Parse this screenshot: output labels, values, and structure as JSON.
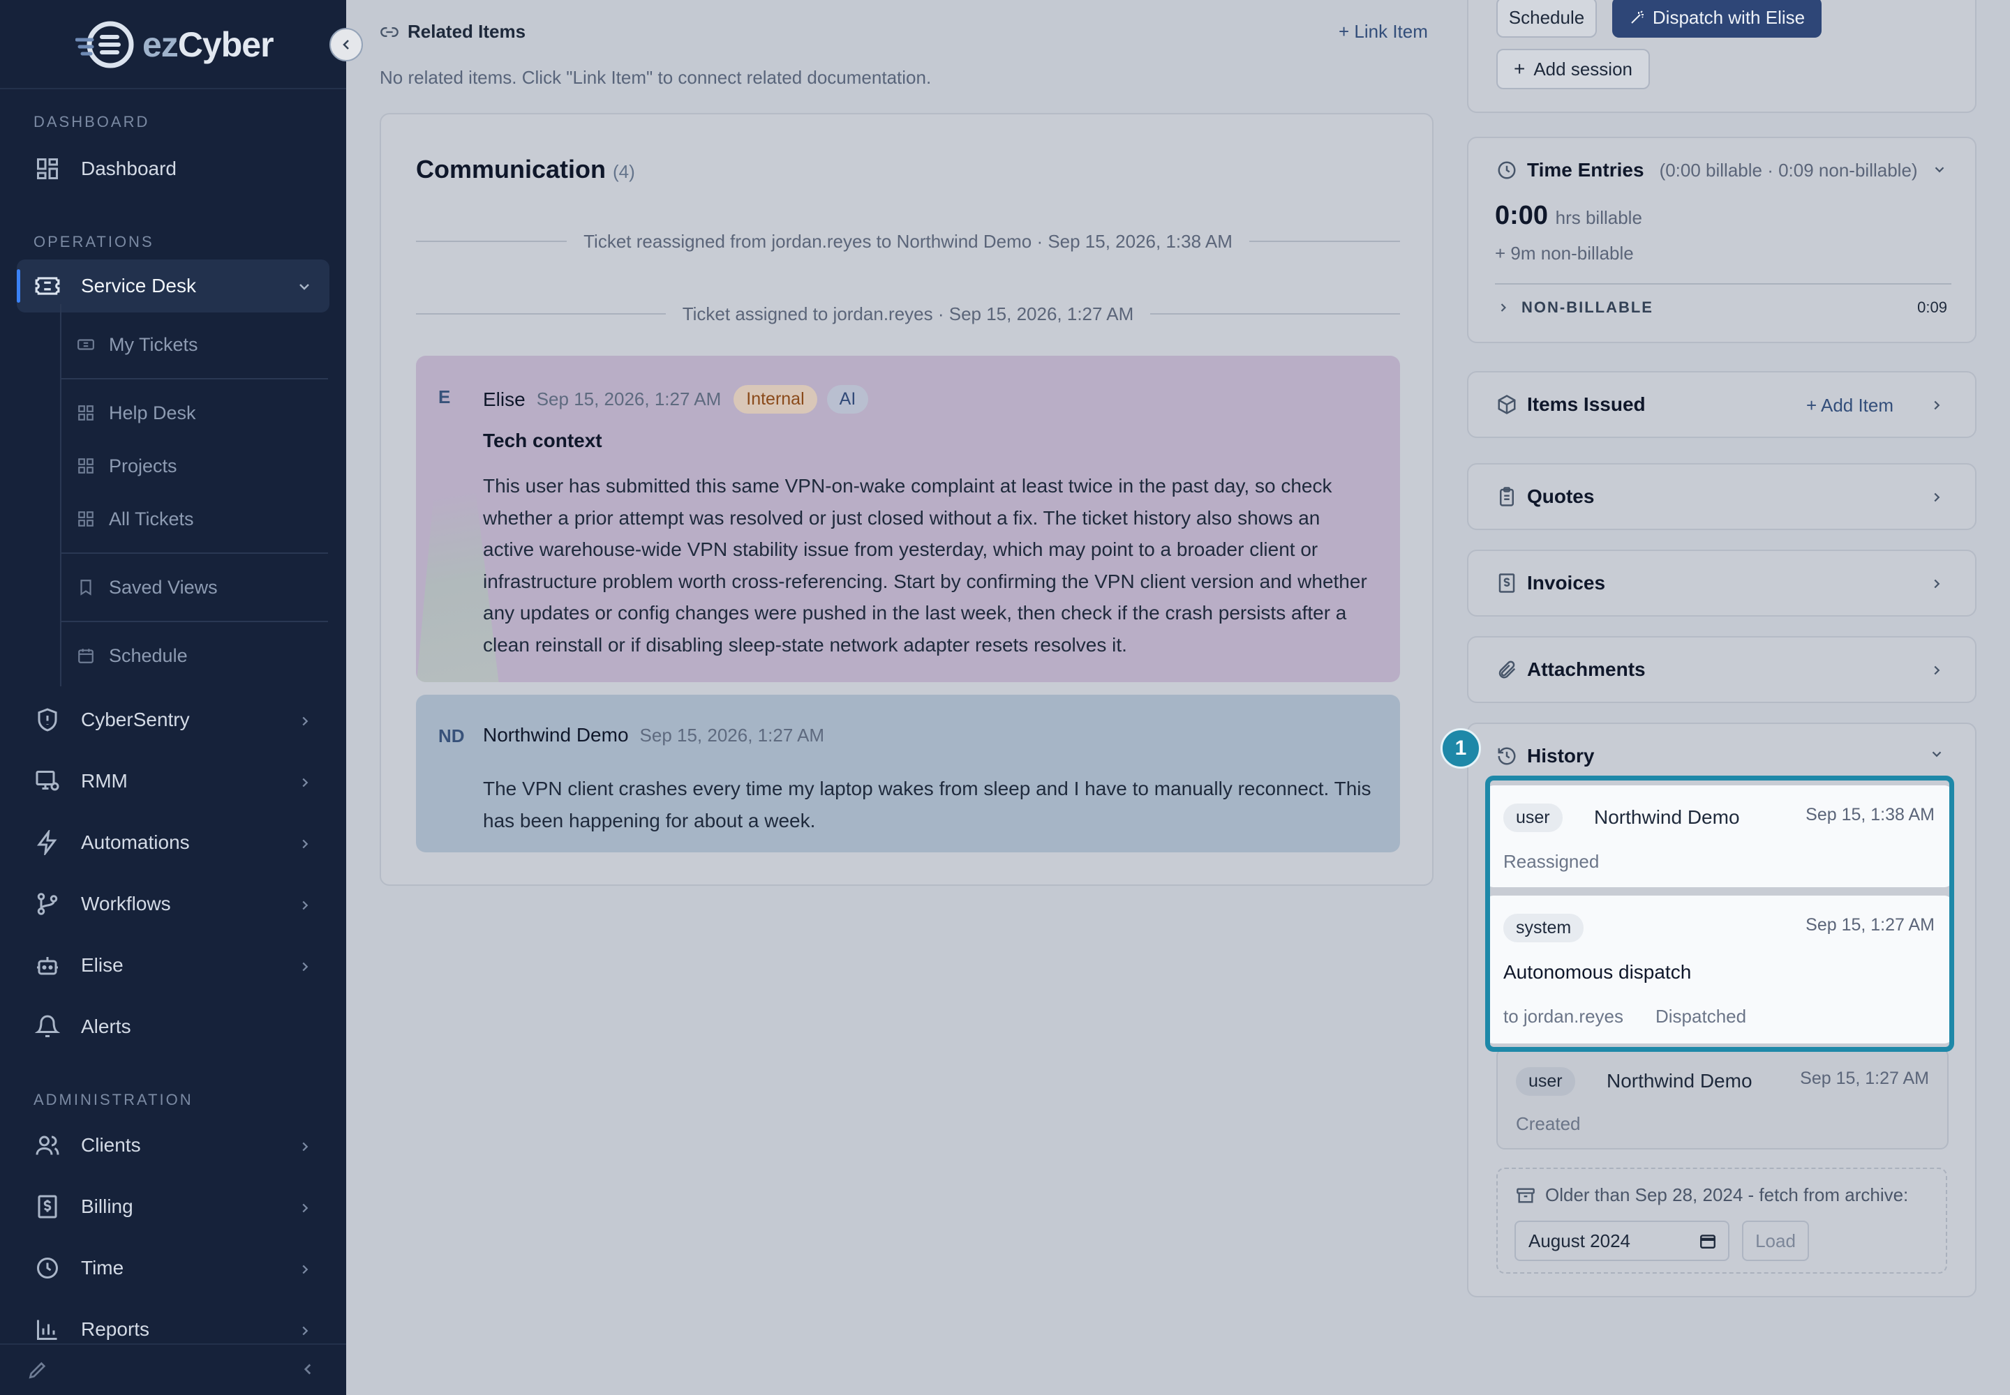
{
  "app": {
    "brand_prefix": "ez",
    "brand_suffix": "Cyber"
  },
  "sidebar": {
    "sections": {
      "dashboard": "DASHBOARD",
      "operations": "OPERATIONS",
      "administration": "ADMINISTRATION"
    },
    "items": {
      "dashboard": "Dashboard",
      "service_desk": "Service Desk",
      "cybersentry": "CyberSentry",
      "rmm": "RMM",
      "automations": "Automations",
      "workflows": "Workflows",
      "elise": "Elise",
      "alerts": "Alerts",
      "clients": "Clients",
      "billing": "Billing",
      "time": "Time",
      "reports": "Reports"
    },
    "service_desk_sub": {
      "my_tickets": "My Tickets",
      "help_desk": "Help Desk",
      "projects": "Projects",
      "all_tickets": "All Tickets",
      "saved_views": "Saved Views",
      "schedule": "Schedule"
    }
  },
  "related": {
    "title": "Related Items",
    "link_label": "+ Link Item",
    "empty_text": "No related items. Click \"Link Item\" to connect related documentation."
  },
  "communication": {
    "title": "Communication",
    "count": "(4)",
    "events": [
      "Ticket reassigned from jordan.reyes to Northwind Demo · Sep 15, 2026, 1:38 AM",
      "Ticket assigned to jordan.reyes · Sep 15, 2026, 1:27 AM"
    ],
    "messages": [
      {
        "avatar": "E",
        "author": "Elise",
        "time": "Sep 15, 2026, 1:27 AM",
        "badge_internal": "Internal",
        "badge_ai": "AI",
        "heading": "Tech context",
        "body": "This user has submitted this same VPN-on-wake complaint at least twice in the past day, so check whether a prior attempt was resolved or just closed without a fix. The ticket history also shows an active warehouse-wide VPN stability issue from yesterday, which may point to a broader client or infrastructure problem worth cross-referencing. Start by confirming the VPN client version and whether any updates or config changes were pushed in the last week, then check if the crash persists after a clean reinstall or if disabling sleep-state network adapter resets resolves it."
      },
      {
        "avatar": "ND",
        "author": "Northwind Demo",
        "time": "Sep 15, 2026, 1:27 AM",
        "body": "The VPN client crashes every time my laptop wakes from sleep and I have to manually reconnect. This has been happening for about a week."
      }
    ]
  },
  "dispatch": {
    "schedule_label": "Schedule",
    "dispatch_label": "Dispatch with Elise",
    "add_session_label": "Add session"
  },
  "time_entries": {
    "title": "Time Entries",
    "summary": "(0:00 billable · 0:09 non-billable)",
    "billable_value": "0:00",
    "billable_unit": "hrs billable",
    "nonbillable_note": "+ 9m non-billable",
    "nonbillable_label": "NON-BILLABLE",
    "nonbillable_value": "0:09"
  },
  "panels": {
    "items_issued": "Items Issued",
    "add_item": "+ Add Item",
    "quotes": "Quotes",
    "invoices": "Invoices",
    "attachments": "Attachments"
  },
  "history": {
    "title": "History",
    "marker": "1",
    "entries": [
      {
        "chip": "user",
        "name": "Northwind Demo",
        "time": "Sep 15, 1:38 AM",
        "action": "Reassigned"
      },
      {
        "chip": "system",
        "time": "Sep 15, 1:27 AM",
        "title": "Autonomous dispatch",
        "detail": "to jordan.reyes",
        "status": "Dispatched"
      },
      {
        "chip": "user",
        "name": "Northwind Demo",
        "time": "Sep 15, 1:27 AM",
        "action": "Created"
      }
    ],
    "archive_label": "Older than Sep 28, 2024 - fetch from archive:",
    "archive_month": "August 2024",
    "load_label": "Load"
  },
  "colors": {
    "sidebar_bg": "#16223a",
    "accent": "#2e4677",
    "highlight": "#1e88a8",
    "internal_badge": "#8a4a1a"
  }
}
